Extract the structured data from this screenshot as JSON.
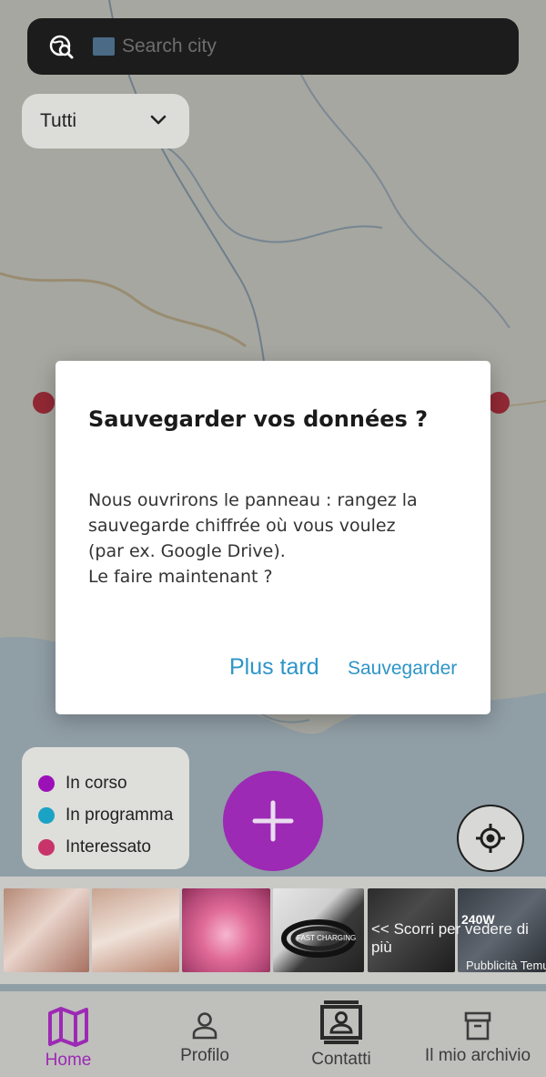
{
  "search": {
    "placeholder": "Search city",
    "icon": "globe-search-icon",
    "flag_icon": "flag-icon"
  },
  "filter": {
    "selected": "Tutti",
    "icon": "chevron-down-icon"
  },
  "legend": {
    "items": [
      {
        "label": "In corso",
        "color": "#9c10b8"
      },
      {
        "label": "In programma",
        "color": "#1aa3c4"
      },
      {
        "label": "Interessato",
        "color": "#c8336a"
      }
    ]
  },
  "fab": {
    "icon": "plus-icon",
    "color": "#9c2ab4"
  },
  "locate": {
    "icon": "crosshair-icon"
  },
  "ads": {
    "hint": "<< Scorri per vedere di più",
    "badge": "Pubblicità Temu",
    "thumbs": [
      "nails-photo",
      "manicure-photo",
      "lips-photo",
      "usb-cable-photo",
      "charger-photo",
      "asus-phone-photo"
    ],
    "product_text": {
      "cable": "FAST CHARGING",
      "charger": "240W"
    }
  },
  "nav": {
    "items": [
      {
        "label": "Home",
        "icon": "map-icon",
        "active": true
      },
      {
        "label": "Profilo",
        "icon": "person-icon",
        "active": false
      },
      {
        "label": "Contatti",
        "icon": "contacts-icon",
        "active": false
      },
      {
        "label": "Il mio archivio",
        "icon": "archive-icon",
        "active": false
      }
    ]
  },
  "dialog": {
    "title": "Sauvegarder vos données ?",
    "message_lines": [
      "Nous ouvrirons le panneau : rangez la",
      "sauvegarde chiffrée où vous voulez",
      "(par ex. Google Drive).",
      "Le faire maintenant ?"
    ],
    "later_label": "Plus tard",
    "save_label": "Sauvegarder",
    "accent": "#2e95c8"
  }
}
